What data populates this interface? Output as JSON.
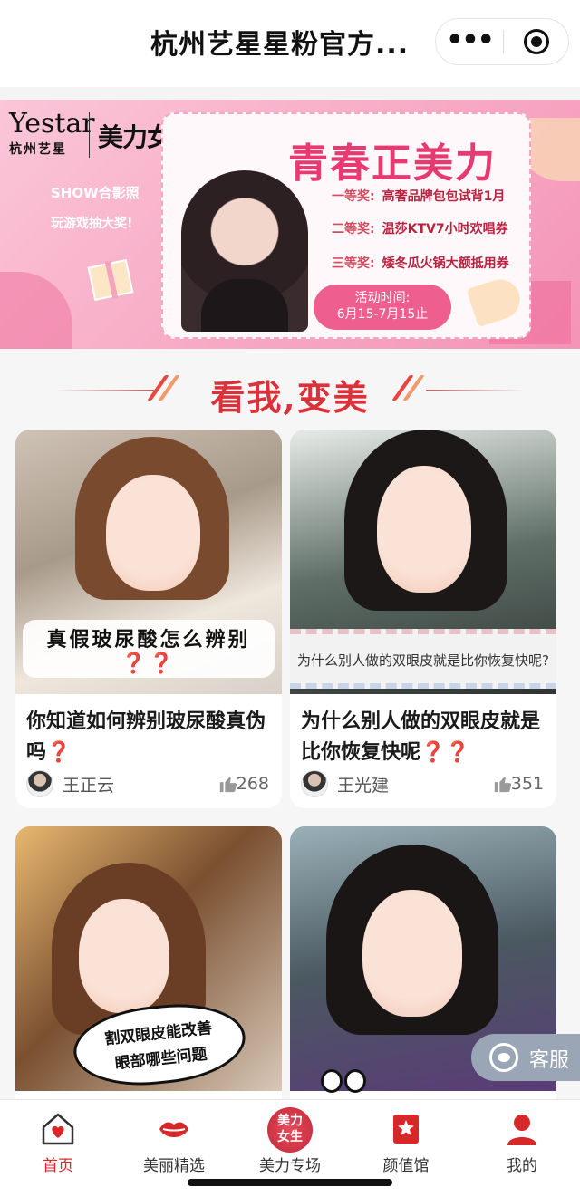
{
  "header": {
    "title": "杭州艺星星粉官方...",
    "more_label": "•••"
  },
  "banner": {
    "brand_en": "Yestar",
    "brand_cn": "杭州艺星",
    "brand2": "美力女生",
    "promo_line1": "SHOW合影照",
    "promo_line2": "玩游戏抽大奖!",
    "headline": "青春正美力",
    "prizes": [
      {
        "rank": "一等奖:",
        "text": "高奢品牌包包试背1月"
      },
      {
        "rank": "二等奖:",
        "text": "温莎KTV7小时欢唱券"
      },
      {
        "rank": "三等奖:",
        "text": "矮冬瓜火锅大额抵用券"
      }
    ],
    "event_label": "活动时间:",
    "event_dates": "6月15-7月15止"
  },
  "section": {
    "title": "看我,变美"
  },
  "cards": [
    {
      "caption": "真假玻尿酸怎么辨别",
      "caption_marks": "❓❓",
      "title": "你知道如何辨别玻尿酸真伪吗",
      "title_marks": "❓",
      "author": "王正云",
      "likes": "268"
    },
    {
      "caption": "为什么别人做的双眼皮就是比你恢复快呢?",
      "title": "为什么别人做的双眼皮就是比你恢复快呢",
      "title_marks": "❓❓",
      "author": "王光建",
      "likes": "351"
    },
    {
      "caption_l1": "割双眼皮能改善",
      "caption_l2": "眼部哪些问题"
    },
    {}
  ],
  "service": {
    "label": "客服"
  },
  "tabbar": {
    "items": [
      {
        "label": "首页",
        "icon": "home-heart-icon",
        "active": true
      },
      {
        "label": "美丽精选",
        "icon": "lips-icon"
      },
      {
        "label": "美力专场",
        "icon": "meili-logo-icon",
        "logo_l1": "美力",
        "logo_l2": "女生"
      },
      {
        "label": "颜值馆",
        "icon": "star-book-icon"
      },
      {
        "label": "我的",
        "icon": "user-icon"
      }
    ]
  },
  "colors": {
    "accent_red": "#d62828",
    "banner_pink": "#f7a9c4",
    "headline_pink": "#e83a72",
    "service_gray": "#9aa6b6"
  }
}
